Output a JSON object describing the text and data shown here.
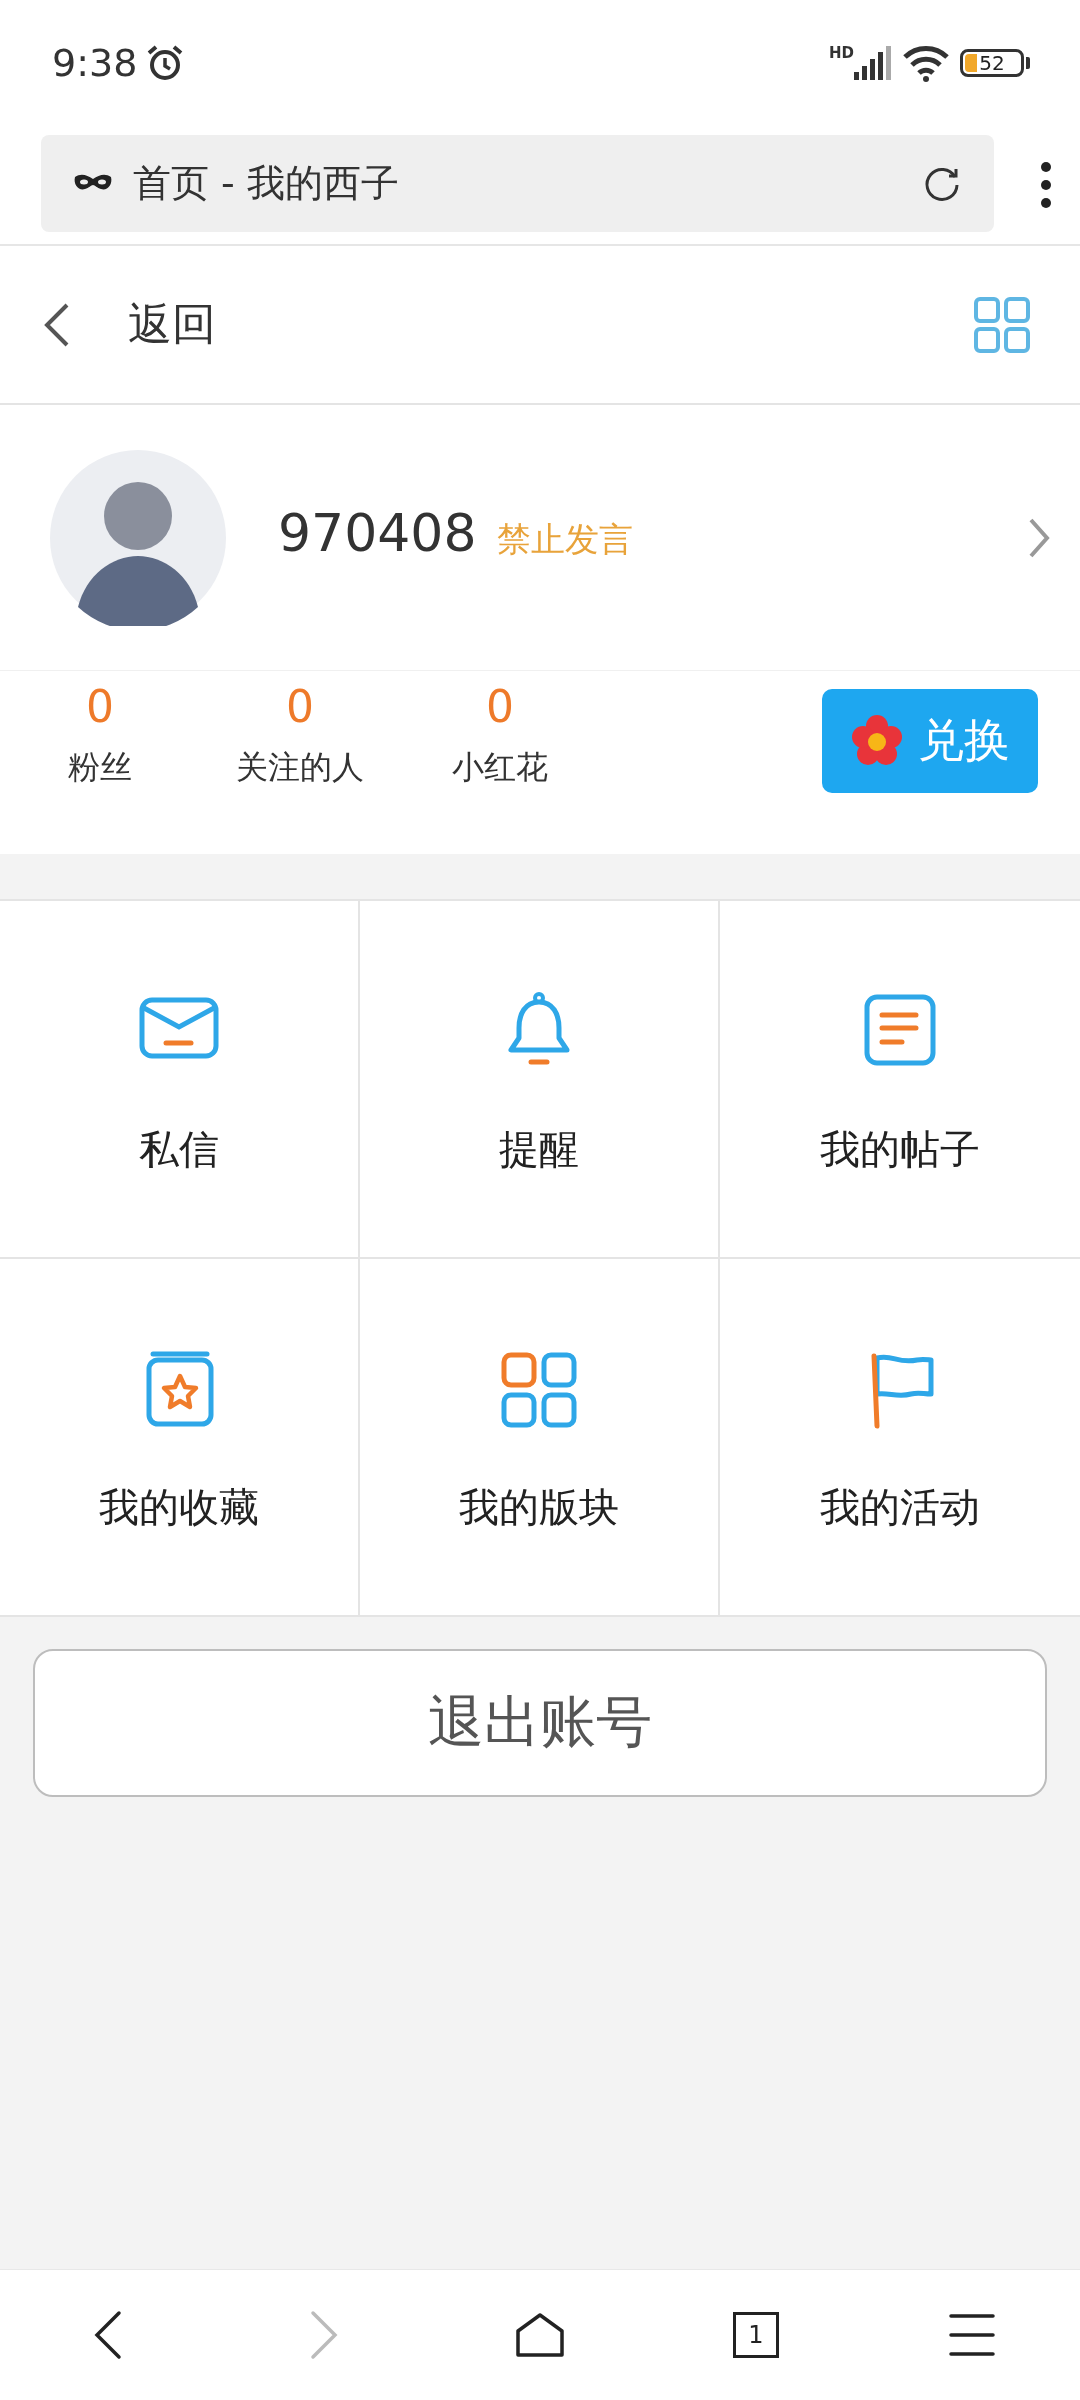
{
  "status_bar": {
    "time": "9:38",
    "network": "HD",
    "battery": "52"
  },
  "browser": {
    "title": "首页 - 我的西子"
  },
  "header": {
    "back_label": "返回"
  },
  "profile": {
    "username": "970408",
    "badge": "禁止发言"
  },
  "stats": [
    {
      "value": "0",
      "label": "粉丝"
    },
    {
      "value": "0",
      "label": "关注的人"
    },
    {
      "value": "0",
      "label": "小红花"
    }
  ],
  "exchange_button": {
    "label": "兑换"
  },
  "menu": [
    {
      "kind": "mail",
      "label": "私信"
    },
    {
      "kind": "bell",
      "label": "提醒"
    },
    {
      "kind": "posts",
      "label": "我的帖子"
    },
    {
      "kind": "favorites",
      "label": "我的收藏"
    },
    {
      "kind": "boards",
      "label": "我的版块"
    },
    {
      "kind": "activity",
      "label": "我的活动"
    }
  ],
  "logout_button": {
    "label": "退出账号"
  },
  "bottom_nav": [
    {
      "kind": "back",
      "disabled": false
    },
    {
      "kind": "forward",
      "disabled": true
    },
    {
      "kind": "home",
      "disabled": false
    },
    {
      "kind": "tabs",
      "label": "1",
      "disabled": false
    },
    {
      "kind": "menu",
      "disabled": false
    }
  ]
}
